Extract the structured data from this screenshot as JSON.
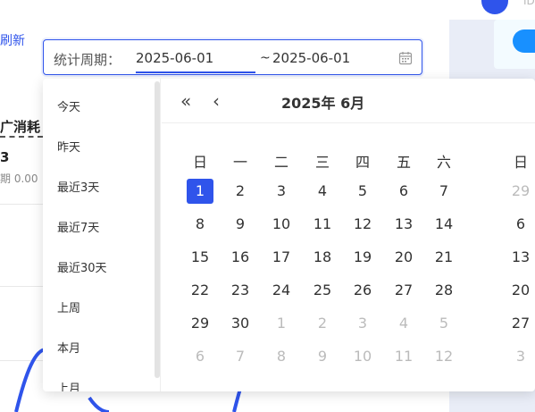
{
  "header": {
    "user_text": "ID"
  },
  "toolbar": {
    "refresh_label": "刷新"
  },
  "summary_card": {
    "title": "广消耗",
    "value": "3",
    "compare": "期 0.00"
  },
  "date_range": {
    "label": "统计周期：",
    "start": "2025-06-01",
    "separator": "~",
    "end": "2025-06-01"
  },
  "presets": [
    "今天",
    "昨天",
    "最近3天",
    "最近7天",
    "最近30天",
    "上周",
    "本月",
    "上月"
  ],
  "calendar": {
    "title": "2025年 6月",
    "nav_double_prev": "«",
    "nav_prev": "‹",
    "weekdays": [
      "日",
      "一",
      "二",
      "三",
      "四",
      "五",
      "六"
    ],
    "weeks": [
      [
        "1",
        "2",
        "3",
        "4",
        "5",
        "6",
        "7"
      ],
      [
        "8",
        "9",
        "10",
        "11",
        "12",
        "13",
        "14"
      ],
      [
        "15",
        "16",
        "17",
        "18",
        "19",
        "20",
        "21"
      ],
      [
        "22",
        "23",
        "24",
        "25",
        "26",
        "27",
        "28"
      ],
      [
        "29",
        "30",
        "1",
        "2",
        "3",
        "4",
        "5"
      ],
      [
        "6",
        "7",
        "8",
        "9",
        "10",
        "11",
        "12"
      ]
    ],
    "selected_day": "1",
    "next_month_weekday": "日",
    "next_month_first_column": [
      "29",
      "6",
      "13",
      "20",
      "27",
      "3"
    ]
  },
  "colors": {
    "accent": "#2f54eb",
    "muted": "#bbbbbb"
  }
}
